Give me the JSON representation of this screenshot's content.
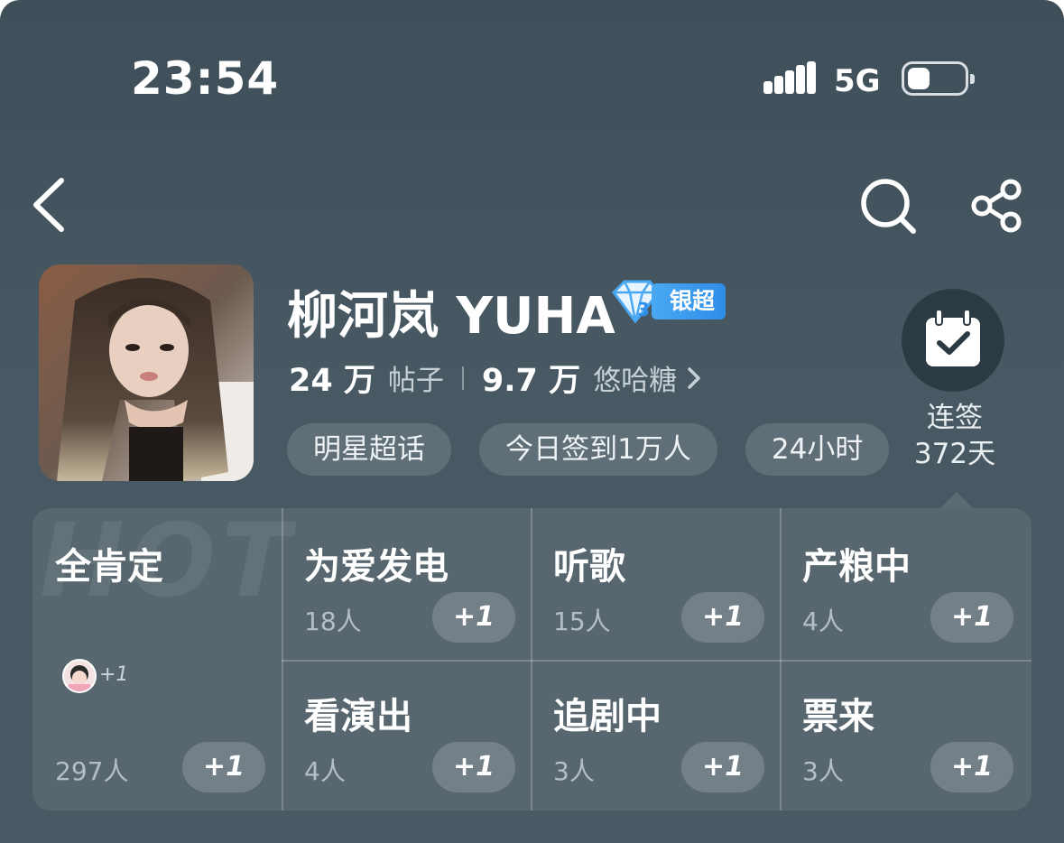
{
  "status_bar": {
    "time": "23:54",
    "network": "5G"
  },
  "nav": {
    "back_icon": "chevron-left-icon",
    "search_icon": "search-icon",
    "share_icon": "share-icon"
  },
  "profile": {
    "name": "柳河岚 YUHA",
    "badge_label": "银超",
    "stats": [
      {
        "value": "24 万",
        "label": "帖子"
      },
      {
        "value": "9.7 万",
        "label": "悠哈糖"
      }
    ],
    "chips": [
      "明星超话",
      "今日签到1万人",
      "24小时"
    ]
  },
  "checkin": {
    "icon": "calendar-check-icon",
    "label": "连签",
    "days": "372天"
  },
  "grid": {
    "watermark": "HOT",
    "featured": {
      "title": "全肯定",
      "count": "297人",
      "plus": "+1",
      "mini_plus": "+1"
    },
    "items": [
      {
        "title": "为爱发电",
        "count": "18人",
        "plus": "+1"
      },
      {
        "title": "听歌",
        "count": "15人",
        "plus": "+1"
      },
      {
        "title": "产粮中",
        "count": "4人",
        "plus": "+1"
      },
      {
        "title": "看演出",
        "count": "4人",
        "plus": "+1"
      },
      {
        "title": "追剧中",
        "count": "3人",
        "plus": "+1"
      },
      {
        "title": "票来",
        "count": "3人",
        "plus": "+1"
      }
    ]
  }
}
